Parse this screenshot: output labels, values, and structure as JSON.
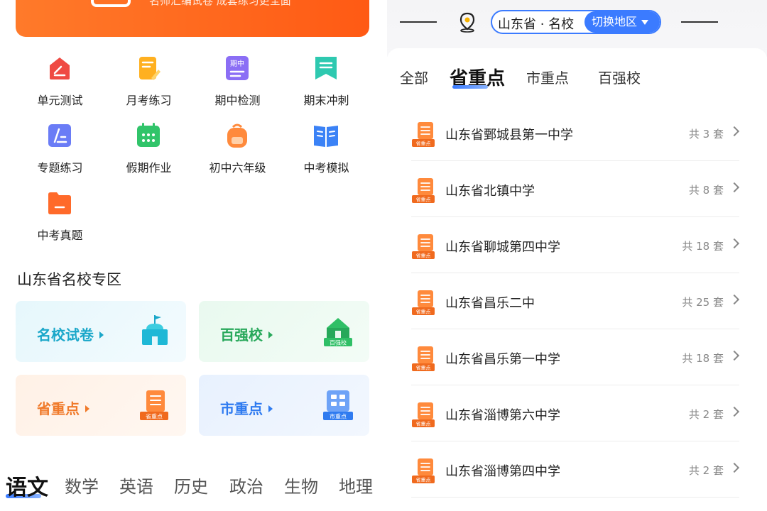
{
  "left": {
    "banner_text": "名师汇编试卷 成套练习更全面",
    "grid": [
      {
        "label": "单元测试",
        "icon": "unit-test-icon",
        "color": "#ef4a43"
      },
      {
        "label": "月考练习",
        "icon": "monthly-exam-icon",
        "color": "#ffb020"
      },
      {
        "label": "期中检测",
        "icon": "midterm-icon",
        "color": "#8b6ef5",
        "icon_text": "期中"
      },
      {
        "label": "期末冲刺",
        "icon": "final-sprint-icon",
        "color": "#2ec9b0"
      },
      {
        "label": "专题练习",
        "icon": "topic-practice-icon",
        "color": "#6a7cf6"
      },
      {
        "label": "假期作业",
        "icon": "holiday-homework-icon",
        "color": "#31c46a"
      },
      {
        "label": "初中六年级",
        "icon": "grade-six-icon",
        "color": "#ff8a3c"
      },
      {
        "label": "中考模拟",
        "icon": "mock-exam-icon",
        "color": "#3b82f6"
      },
      {
        "label": "中考真题",
        "icon": "real-exam-icon",
        "color": "#ff6a2a"
      }
    ],
    "section_title": "山东省名校专区",
    "cards": [
      {
        "label": "名校试卷",
        "color": "#1aa7c9",
        "bg": "#eaf8fd",
        "icon": "famous-school-icon"
      },
      {
        "label": "百强校",
        "color": "#27a85a",
        "bg": "#ecfaf1",
        "icon": "top-hundred-icon",
        "icon_text": "百强校"
      },
      {
        "label": "省重点",
        "color": "#f07a2a",
        "bg": "#fff3ea",
        "icon": "province-key-icon",
        "icon_text": "省重点"
      },
      {
        "label": "市重点",
        "color": "#2f7bf0",
        "bg": "#ebf3fe",
        "icon": "city-key-icon",
        "icon_text": "市重点"
      }
    ],
    "subjects": [
      "语文",
      "数学",
      "英语",
      "历史",
      "政治",
      "生物",
      "地理"
    ],
    "active_subject": 0
  },
  "right": {
    "region_text": "山东省 · 名校",
    "switch_label": "切换地区",
    "tabs": [
      "全部",
      "省重点",
      "市重点",
      "百强校"
    ],
    "active_tab": 1,
    "school_icon_text": "省重点",
    "schools": [
      {
        "name": "山东省鄄城县第一中学",
        "count": "共 3 套"
      },
      {
        "name": "山东省北镇中学",
        "count": "共 8 套"
      },
      {
        "name": "山东省聊城第四中学",
        "count": "共 18 套"
      },
      {
        "name": "山东省昌乐二中",
        "count": "共 25 套"
      },
      {
        "name": "山东省昌乐第一中学",
        "count": "共 18 套"
      },
      {
        "name": "山东省淄博第六中学",
        "count": "共 2 套"
      },
      {
        "name": "山东省淄博第四中学",
        "count": "共 2 套"
      }
    ]
  }
}
